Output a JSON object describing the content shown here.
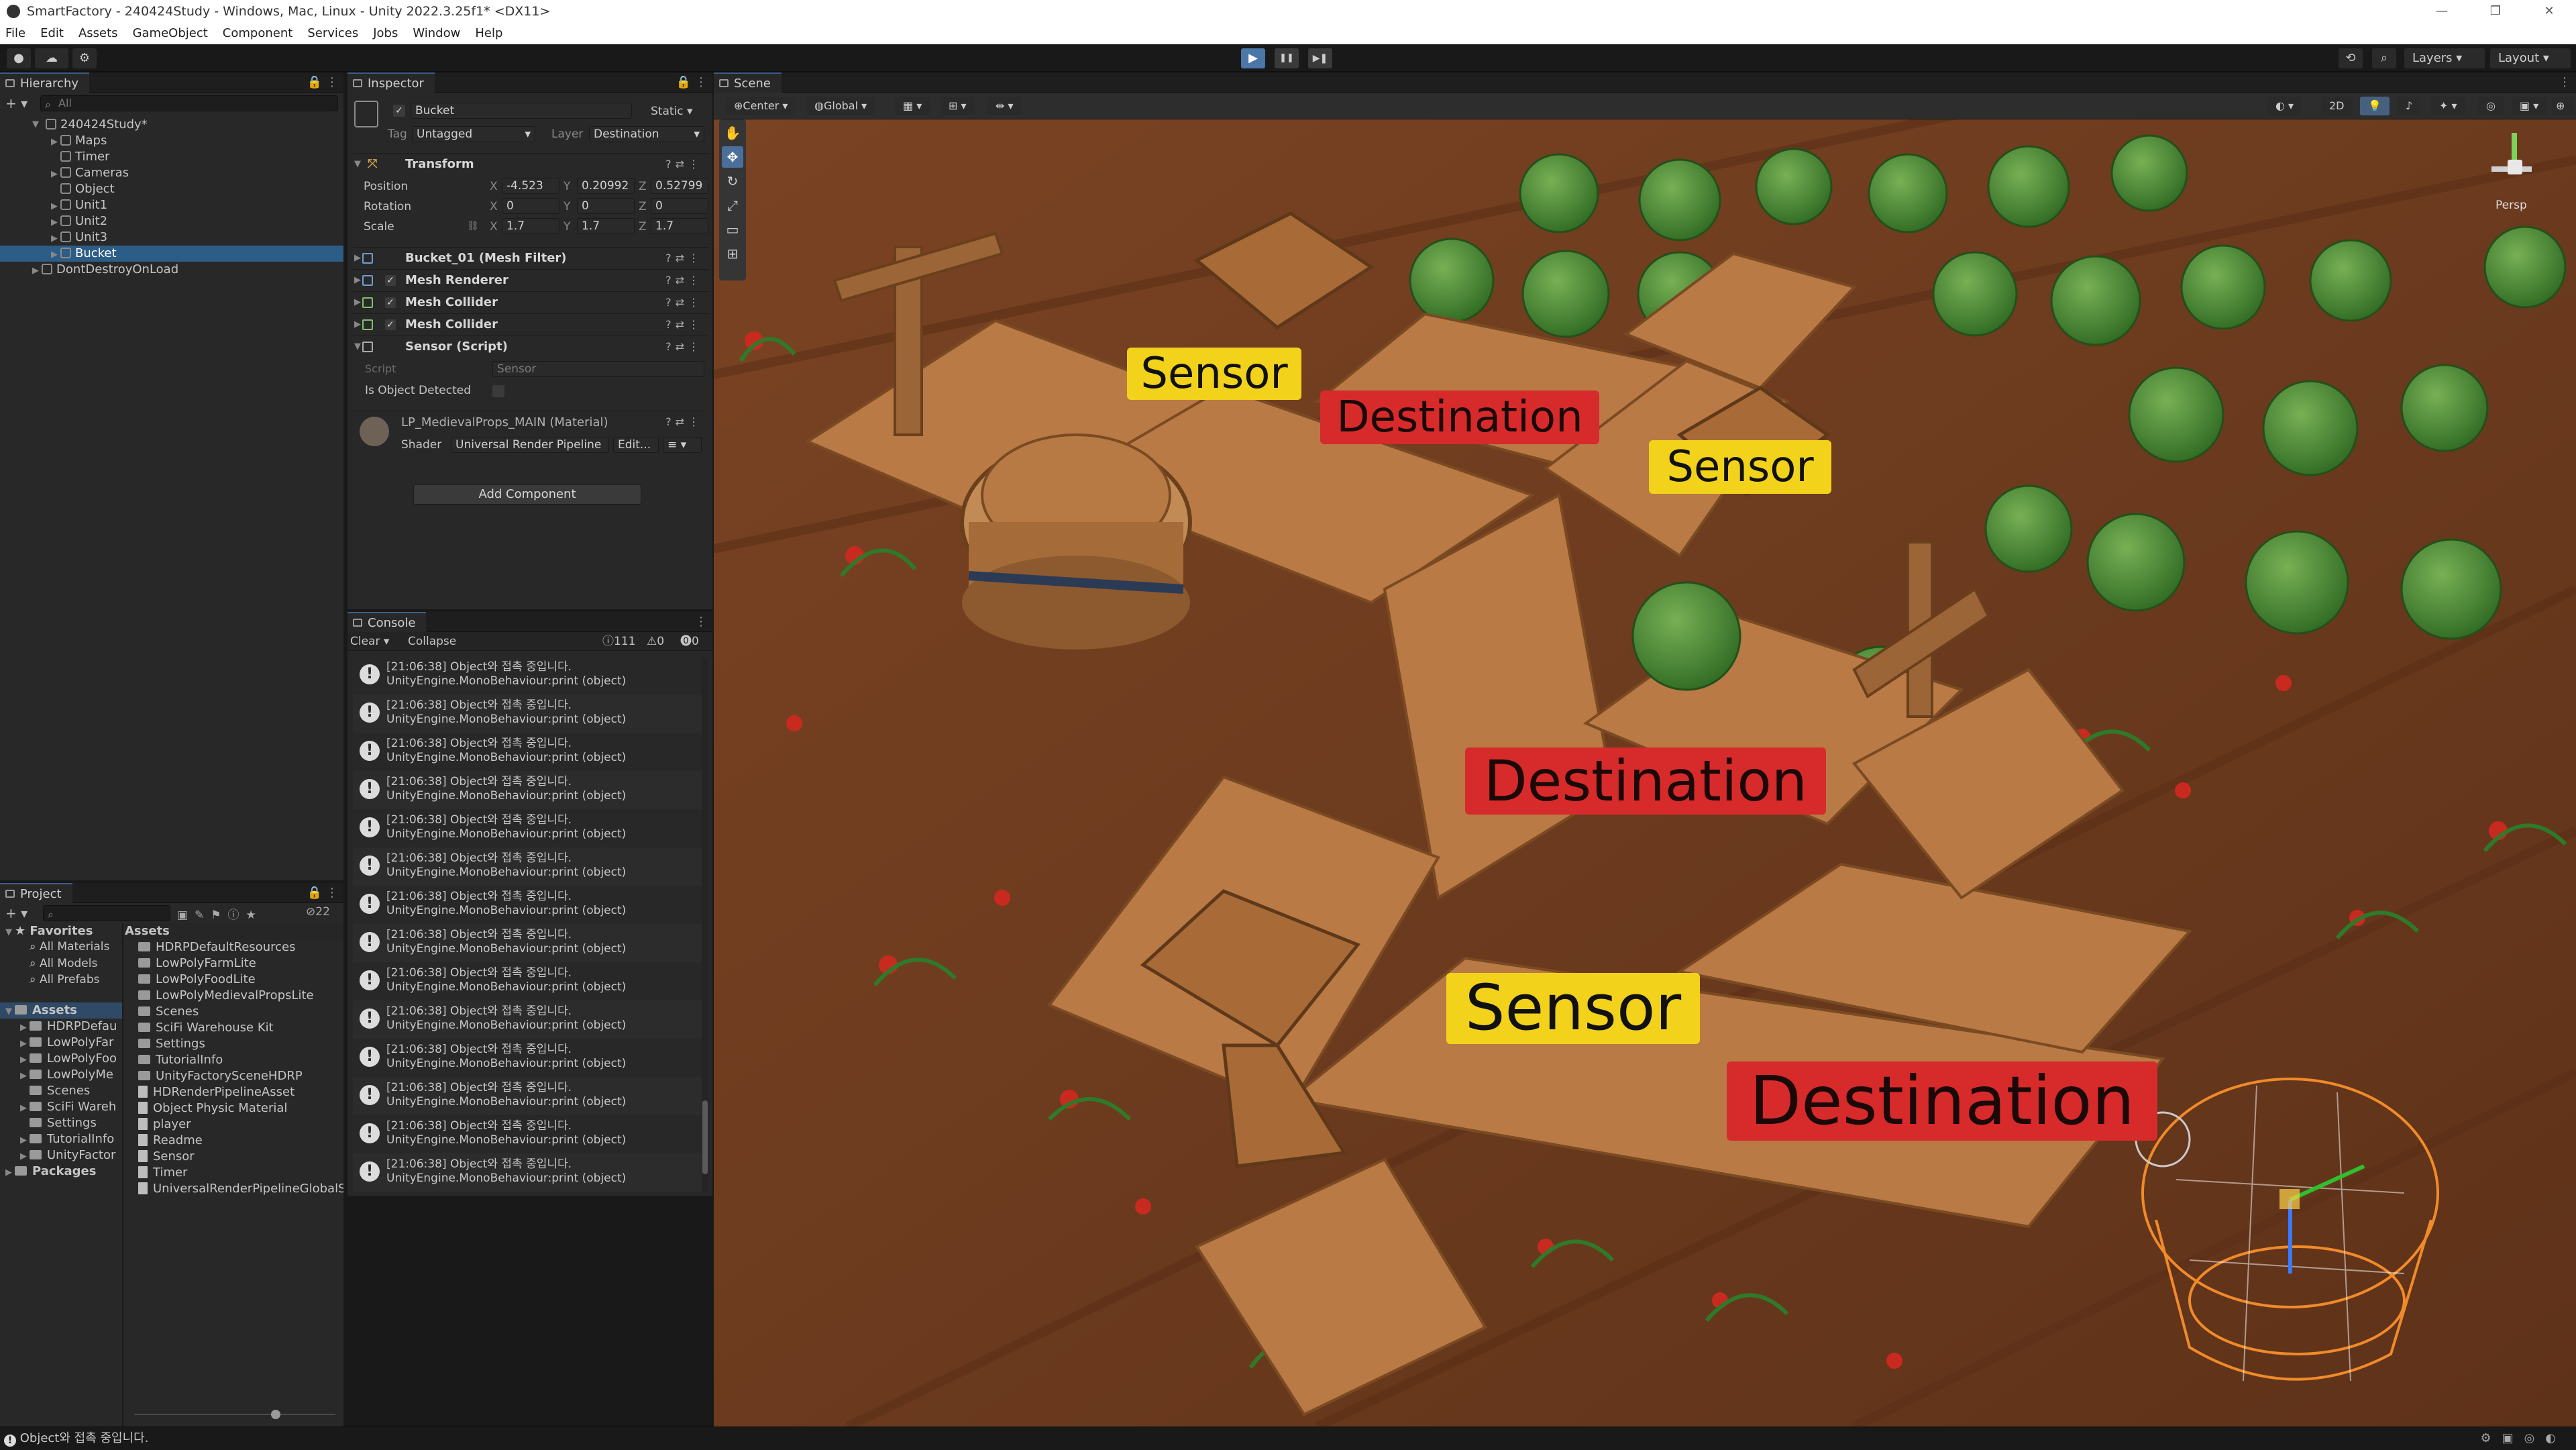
{
  "window": {
    "title": "SmartFactory - 240424Study - Windows, Mac, Linux - Unity 2022.3.25f1* <DX11>",
    "controls": [
      "—",
      "❐",
      "✕"
    ]
  },
  "menu": [
    "File",
    "Edit",
    "Assets",
    "GameObject",
    "Component",
    "Services",
    "Jobs",
    "Window",
    "Help"
  ],
  "toolbar": {
    "play": "▶",
    "pause": "❚❚",
    "step": "▶❚",
    "layers_label": "Layers",
    "layout_label": "Layout"
  },
  "hierarchy": {
    "tab": "Hierarchy",
    "search_placeholder": "All",
    "scene": "240424Study*",
    "items": [
      "Maps",
      "Timer",
      "Cameras",
      "Object",
      "Unit1",
      "Unit2",
      "Unit3",
      "Bucket"
    ],
    "ddol": "DontDestroyOnLoad"
  },
  "inspector": {
    "tab": "Inspector",
    "object_name": "Bucket",
    "static_label": "Static",
    "tag_label": "Tag",
    "tag_value": "Untagged",
    "layer_label": "Layer",
    "layer_value": "Destination",
    "transform": {
      "title": "Transform",
      "position_label": "Position",
      "position": {
        "x": "-4.523",
        "y": "0.20992",
        "z": "0.52799"
      },
      "rotation_label": "Rotation",
      "rotation": {
        "x": "0",
        "y": "0",
        "z": "0"
      },
      "scale_label": "Scale",
      "scale": {
        "x": "1.7",
        "y": "1.7",
        "z": "1.7"
      }
    },
    "axis": {
      "x": "X",
      "y": "Y",
      "z": "Z"
    },
    "components": [
      "Bucket_01 (Mesh Filter)",
      "Mesh Renderer",
      "Mesh Collider",
      "Mesh Collider",
      "Sensor (Script)"
    ],
    "script_label": "Script",
    "script_value": "Sensor",
    "detected_label": "Is Object Detected",
    "material_name": "LP_MedievalProps_MAIN (Material)",
    "shader_label": "Shader",
    "shader_value": "Universal Render Pipeline",
    "edit_label": "Edit...",
    "add_component": "Add Component"
  },
  "console": {
    "tab": "Console",
    "clear": "Clear",
    "collapse": "Collapse",
    "info_count": "111",
    "warn_count": "0",
    "error_count": "0",
    "line1": "[21:06:38] Object와 접촉 중입니다.",
    "line2": "UnityEngine.MonoBehaviour:print (object)",
    "rows": 14
  },
  "project": {
    "tab": "Project",
    "hidden_count": "22",
    "favorites": "Favorites",
    "fav_items": [
      "All Materials",
      "All Models",
      "All Prefabs"
    ],
    "assets_label": "Assets",
    "tree": [
      "HDRPDefau",
      "LowPolyFar",
      "LowPolyFoo",
      "LowPolyMe",
      "Scenes",
      "SciFi Wareh",
      "Settings",
      "TutorialInfo",
      "UnityFactor"
    ],
    "packages": "Packages",
    "assets_header": "Assets",
    "assets": [
      {
        "name": "HDRPDefaultResources",
        "kind": "folder"
      },
      {
        "name": "LowPolyFarmLite",
        "kind": "folder"
      },
      {
        "name": "LowPolyFoodLite",
        "kind": "folder"
      },
      {
        "name": "LowPolyMedievalPropsLite",
        "kind": "folder"
      },
      {
        "name": "Scenes",
        "kind": "folder"
      },
      {
        "name": "SciFi Warehouse Kit",
        "kind": "folder"
      },
      {
        "name": "Settings",
        "kind": "folder"
      },
      {
        "name": "TutorialInfo",
        "kind": "folder"
      },
      {
        "name": "UnityFactorySceneHDRP",
        "kind": "folder"
      },
      {
        "name": "HDRenderPipelineAsset",
        "kind": "file"
      },
      {
        "name": "Object Physic Material",
        "kind": "file"
      },
      {
        "name": "player",
        "kind": "file"
      },
      {
        "name": "Readme",
        "kind": "file"
      },
      {
        "name": "Sensor",
        "kind": "file"
      },
      {
        "name": "Timer",
        "kind": "file"
      },
      {
        "name": "UniversalRenderPipelineGlobalS",
        "kind": "file"
      }
    ]
  },
  "scene": {
    "tab": "Scene",
    "pivot": "Center",
    "space": "Global",
    "mode": "2D",
    "persp": "Persp",
    "labels": {
      "sensor1": "Sensor",
      "dest1": "Destination",
      "sensor2": "Sensor",
      "dest2": "Destination",
      "sensor3": "Sensor",
      "dest3": "Destination"
    },
    "colors": {
      "sensor": "#f2d21a",
      "destination": "#d72a2a",
      "soil": "#6b3a1c",
      "wood": "#b97a45",
      "cabbage": "#3e7a2e"
    }
  },
  "status": {
    "message": "Object와 접촉 중입니다."
  }
}
